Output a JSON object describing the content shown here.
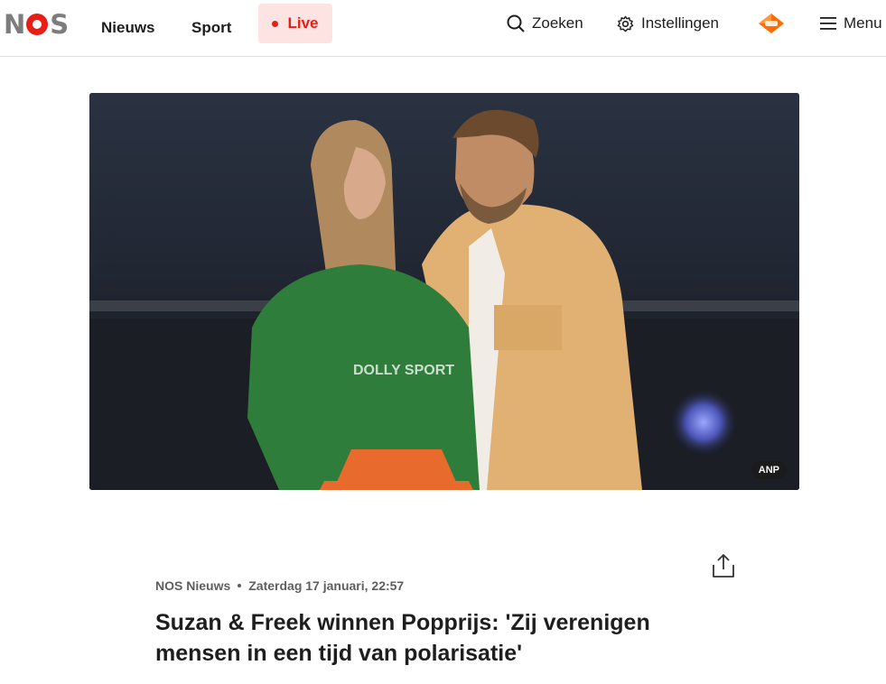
{
  "header": {
    "logo_alt": "NOS",
    "nav": {
      "nieuws": "Nieuws",
      "sport": "Sport",
      "live": "Live"
    },
    "zoeken_label": "Zoeken",
    "instellingen_label": "Instellingen",
    "npo_badge_icon": "npo-start-icon",
    "menu_label": "Menu"
  },
  "hero": {
    "credit": "ANP",
    "shirt_text": "DOLLY SPORT"
  },
  "article": {
    "source": "NOS Nieuws",
    "date": "Zaterdag 17 januari, 22:57",
    "headline": "Suzan & Freek winnen Popprijs: 'Zij verenigen mensen in een tijd van polarisatie'"
  },
  "colors": {
    "brand_red": "#e61e14",
    "live_bg": "#fde4e3",
    "text": "#1e1e1e",
    "meta": "#5e5e5e"
  }
}
